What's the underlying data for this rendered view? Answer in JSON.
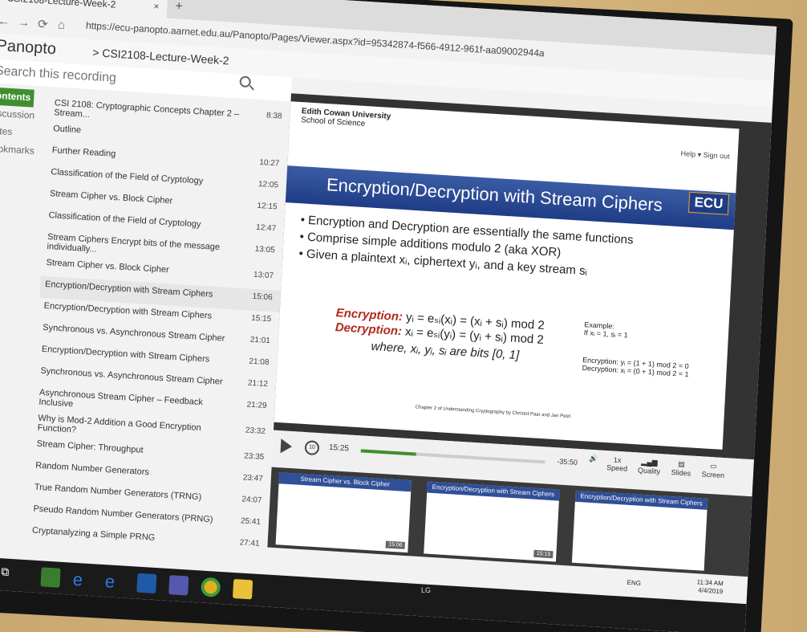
{
  "browser": {
    "tab_title": "CSI2108-Lecture-Week-2",
    "tab_close": "×",
    "new_tab": "+",
    "url": "https://ecu-panopto.aarnet.edu.au/Panopto/Pages/Viewer.aspx?id=95342874-f566-4912-961f-aa09002944a"
  },
  "panopto": {
    "logo": "Panopto",
    "breadcrumb_sep": ">",
    "breadcrumb": "CSI2108-Lecture-Week-2",
    "search_placeholder": "Search this recording"
  },
  "left_tabs": [
    "Contents",
    "Discussion",
    "Notes",
    "Bookmarks"
  ],
  "outline": [
    {
      "title": "CSI 2108: Cryptographic Concepts Chapter 2 – Stream...",
      "time": "8:38"
    },
    {
      "title": "Outline",
      "time": ""
    },
    {
      "title": "Further Reading",
      "time": "10:27"
    },
    {
      "title": "Classification of the Field of Cryptology",
      "time": "12:05"
    },
    {
      "title": "Stream Cipher vs. Block Cipher",
      "time": "12:15"
    },
    {
      "title": "Classification of the Field of Cryptology",
      "time": "12:47"
    },
    {
      "title": "Stream Ciphers Encrypt bits of the message individually...",
      "time": "13:05"
    },
    {
      "title": "Stream Cipher vs. Block Cipher",
      "time": "13:07"
    },
    {
      "title": "Encryption/Decryption with Stream Ciphers",
      "time": "15:06",
      "selected": true
    },
    {
      "title": "Encryption/Decryption with Stream Ciphers",
      "time": "15:15"
    },
    {
      "title": "Synchronous vs. Asynchronous Stream Cipher",
      "time": "21:01"
    },
    {
      "title": "Encryption/Decryption with Stream Ciphers",
      "time": "21:08"
    },
    {
      "title": "Synchronous vs. Asynchronous Stream Cipher",
      "time": "21:12"
    },
    {
      "title": "Asynchronous Stream Cipher – Feedback Inclusive",
      "time": "21:29"
    },
    {
      "title": "Why is Mod-2 Addition a Good Encryption Function?",
      "time": "23:32"
    },
    {
      "title": "Stream Cipher: Throughput",
      "time": "23:35"
    },
    {
      "title": "Random Number Generators",
      "time": "23:47"
    },
    {
      "title": "True Random Number Generators (TRNG)",
      "time": "24:07"
    },
    {
      "title": "Pseudo Random Number Generators (PRNG)",
      "time": "25:41"
    },
    {
      "title": "Cryptanalyzing a Simple PRNG",
      "time": "27:41"
    }
  ],
  "slide": {
    "institution": "Edith Cowan University",
    "school": "School of Science",
    "help": "Help ▾   Sign out",
    "logo": "ECU",
    "title": "Encryption/Decryption with Stream Ciphers",
    "bullets": [
      "Encryption and Decryption are essentially the same functions",
      "Comprise simple additions modulo 2 (aka XOR)",
      "Given a plaintext xᵢ, ciphertext yᵢ, and a key stream sᵢ"
    ],
    "enc_label": "Encryption:",
    "enc_formula": " yᵢ = eₛᵢ(xᵢ) = (xᵢ + sᵢ) mod 2",
    "dec_label": "Decryption:",
    "dec_formula": " xᵢ = eₛᵢ(yᵢ) = (yᵢ + sᵢ) mod 2",
    "where": "where, xᵢ, yᵢ, sᵢ are bits [0, 1]",
    "example_title": "Example:",
    "example_given": "If xᵢ = 1, sᵢ = 1",
    "example_enc": "Encryption: yᵢ = (1 + 1) mod 2 = 0",
    "example_dec": "Decryption: xᵢ = (0 + 1) mod 2 = 1",
    "credit": "Chapter 2 of Understanding Cryptography by Christof Paar and Jan Pelzl"
  },
  "player": {
    "rewind": "10",
    "current_time": "15:25",
    "remaining": "-35:50",
    "progress_fraction": 0.3,
    "speed": "1x",
    "speed_label": "Speed",
    "quality_label": "Quality",
    "slides_label": "Slides",
    "screen_label": "Screen"
  },
  "thumbnails": [
    {
      "title": "Stream Cipher vs. Block Cipher",
      "time": "15:06"
    },
    {
      "title": "Encryption/Decryption with Stream Ciphers",
      "time": "15:15"
    },
    {
      "title": "Encryption/Decryption with Stream Ciphers",
      "time": ""
    }
  ],
  "tray": {
    "lang": "ENG",
    "time": "11:34 AM",
    "date": "4/4/2019"
  },
  "brand": "LG"
}
